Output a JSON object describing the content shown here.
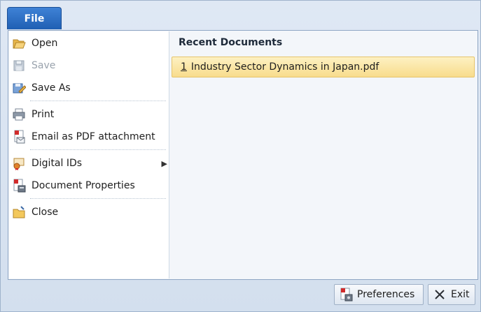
{
  "file_tab": {
    "label": "File"
  },
  "menu": {
    "items": [
      {
        "label": "Open",
        "icon": "folder-open-icon",
        "enabled": true
      },
      {
        "label": "Save",
        "icon": "floppy-disk-icon",
        "enabled": false
      },
      {
        "label": "Save As",
        "icon": "save-as-icon",
        "enabled": true
      },
      {
        "label": "Print",
        "icon": "printer-icon",
        "enabled": true
      },
      {
        "label": "Email as PDF attachment",
        "icon": "email-pdf-icon",
        "enabled": true
      },
      {
        "label": "Digital IDs",
        "icon": "certificate-icon",
        "enabled": true,
        "submenu": true
      },
      {
        "label": "Document Properties",
        "icon": "document-properties-icon",
        "enabled": true
      },
      {
        "label": "Close",
        "icon": "folder-close-icon",
        "enabled": true
      }
    ]
  },
  "recent": {
    "title": "Recent Documents",
    "items": [
      {
        "number": "1",
        "name": "Industry Sector Dynamics in Japan.pdf"
      }
    ]
  },
  "footer": {
    "preferences_label": "Preferences",
    "exit_label": "Exit"
  }
}
